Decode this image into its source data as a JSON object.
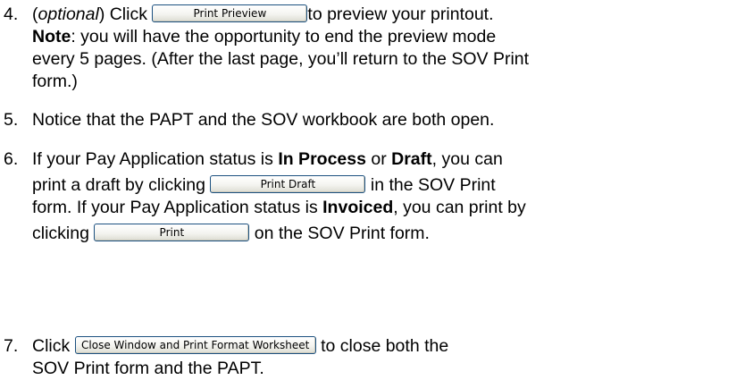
{
  "step4": {
    "number": "4.",
    "open_paren": "(",
    "optional_word": "optional",
    "close_paren_click": ") Click",
    "button_label": "Print Prieview",
    "after_button": "to preview your printout.",
    "note_label": "Note",
    "note_text": ": you will have the opportunity to end the preview mode",
    "line3": "every 5 pages. (After the last page, you’ll return to the SOV Print",
    "line4": "form.)"
  },
  "step5": {
    "number": "5.",
    "text": "Notice that the PAPT and the SOV workbook are both open."
  },
  "step6": {
    "number": "6.",
    "line1_a": "If your Pay Application status is ",
    "status_in_process": "In Process",
    "line1_or": " or ",
    "status_draft": "Draft",
    "line1_b": ", you can",
    "line2_a": "print a draft by clicking",
    "draft_button_label": "Print Draft",
    "line2_b": "in the SOV Print",
    "line3_a": "form.  If your Pay Application status is ",
    "status_invoiced": "Invoiced",
    "line3_b": ", you can print by",
    "line4_a": "clicking",
    "print_button_label": "Print",
    "line4_b": "on the SOV Print form."
  },
  "step7": {
    "number": "7.",
    "click": "Click",
    "button_label": "Close Window and Print Format Worksheet",
    "after_button": "to close both the",
    "line2": "SOV Print form and the PAPT."
  }
}
